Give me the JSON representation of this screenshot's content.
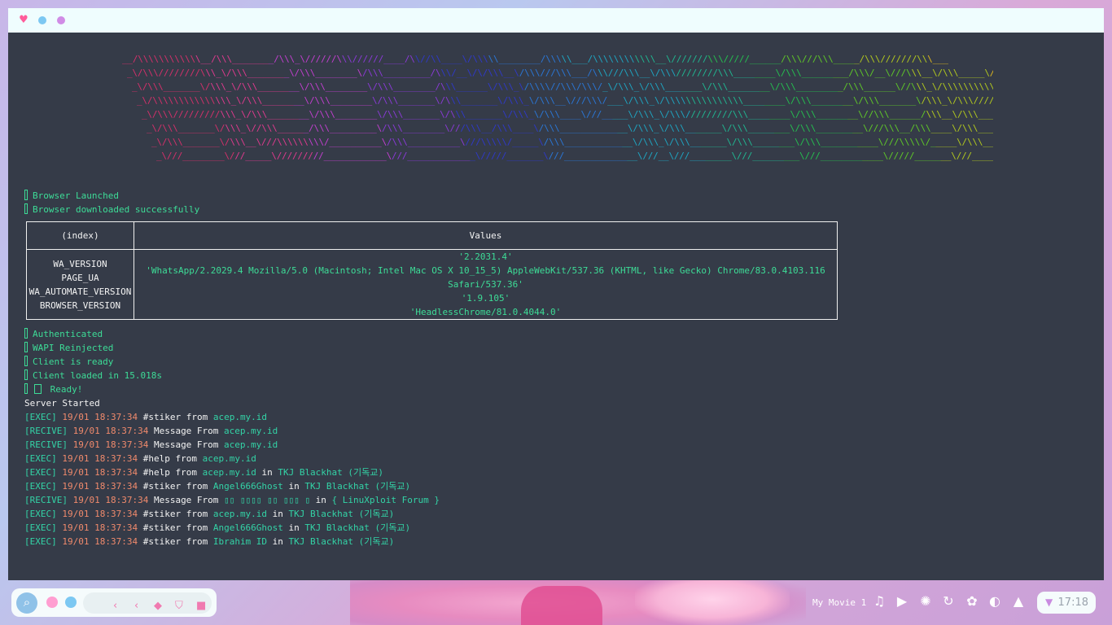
{
  "window": {
    "controls": [
      "close",
      "minimize",
      "maximize"
    ]
  },
  "banner": [
    {
      "text": "__/\\\\\\\\\\\\\\\\\\\\\\\\__/\\\\\\________/\\\\\\_\\//////\\\\\\//////____/\\\\//\\\\____\\/\\\\\\\\\\________/\\\\\\\\\\___/\\\\\\\\\\\\\\\\\\\\\\\\__\\///////\\\\\\/////______/\\\\\\///\\\\\\_____/\\\\\\///////\\\\\\___"
    },
    {
      "text": "_\\/\\\\\\////////\\\\\\_\\/\\\\\\________\\/\\\\\\________\\/\\\\\\_________/\\\\\\/__\\/\\/\\\\\\__\\/\\\\\\///\\\\\\___/\\\\\\///\\\\\\__\\/\\\\\\////////\\\\\\________\\/\\\\\\_________/\\\\\\/__\\///\\\\\\__\\/\\\\\\_____\\/\\\\\\___"
    },
    {
      "text": "_\\/\\\\\\_______\\/\\\\\\_\\/\\\\\\________\\/\\\\\\________\\/\\\\\\________/\\\\\\______\\/\\\\\\_\\/\\\\\\\\//\\\\\\/\\\\\\/_\\/\\\\\\_\\/\\\\\\_______\\/\\\\\\________\\/\\\\\\_________/\\\\\\______\\//\\\\\\_\\/\\\\\\\\\\\\\\\\\\\\\\/____"
    },
    {
      "text": "_\\/\\\\\\\\\\\\\\\\\\\\\\\\\\\\\\_\\/\\\\\\________\\/\\\\\\________\\/\\\\\\_______\\/\\\\\\_______\\/\\\\\\_\\/\\\\\\__\\///\\\\\\/___\\/\\\\\\_\\/\\\\\\\\\\\\\\\\\\\\\\\\\\\\\\________\\/\\\\\\________\\/\\\\\\_______\\/\\\\\\_\\/\\\\\\//////\\\\\\____"
    },
    {
      "text": "_\\/\\\\\\/////////\\\\\\_\\/\\\\\\________\\/\\\\\\________\\/\\\\\\_______\\/\\\\\\_______\\/\\\\\\_\\/\\\\\\____\\///_____\\/\\\\\\_\\/\\\\\\/////////\\\\\\________\\/\\\\\\________\\//\\\\\\______/\\\\\\__\\/\\\\\\____\\//\\\\\\__"
    },
    {
      "text": "_\\/\\\\\\_______\\/\\\\\\_\\//\\\\\\______/\\\\\\_________\\/\\\\\\________\\///\\\\\\__/\\\\\\____\\/\\\\\\_____________\\/\\\\\\_\\/\\\\\\_______\\/\\\\\\________\\/\\\\\\_________\\///\\\\\\__/\\\\\\____\\/\\\\\\_____\\//\\\\\\_"
    },
    {
      "text": "_\\/\\\\\\_______\\/\\\\\\__\\///\\\\\\\\\\\\\\\\\\/__________\\/\\\\\\__________\\///\\\\\\\\\\/_____\\/\\\\\\_____________\\/\\\\\\_\\/\\\\\\_______\\/\\\\\\________\\/\\\\\\___________\\///\\\\\\\\\\/_____\\/\\\\\\______\\//\\\\\\"
    },
    {
      "text": "_\\///________\\///_____\\/////////____________\\///_____________\\/////_______\\///______________\\///__\\///________\\///_________\\///____________\\/////_______\\///________\\///__"
    }
  ],
  "log_top": [
    {
      "text": "Browser Launched"
    },
    {
      "text": "Browser downloaded successfully"
    }
  ],
  "table": {
    "header_index": "(index)",
    "header_values": "Values",
    "keys": [
      "WA_VERSION",
      "PAGE_UA",
      "WA_AUTOMATE_VERSION",
      "BROWSER_VERSION"
    ],
    "values": [
      "'2.2031.4'",
      "'WhatsApp/2.2029.4 Mozilla/5.0 (Macintosh; Intel Mac OS X 10_15_5) AppleWebKit/537.36 (KHTML, like Gecko) Chrome/83.0.4103.116 Safari/537.36'",
      "'1.9.105'",
      "'HeadlessChrome/81.0.4044.0'"
    ]
  },
  "log_mid": [
    {
      "text": "Authenticated"
    },
    {
      "text": "WAPI Reinjected"
    },
    {
      "text": "Client is ready"
    },
    {
      "text": "Client loaded in 15.018s"
    }
  ],
  "ready_text": "Ready!",
  "server_started": "Server Started",
  "events": [
    {
      "tag": "[EXEC]",
      "time": "19/01 18:37:34",
      "cmd": "#stiker",
      "verb": "from",
      "who": "acep.my.id",
      "in": "",
      "group": ""
    },
    {
      "tag": "[RECIVE]",
      "time": "19/01 18:37:34",
      "cmd": "Message",
      "verb": "From",
      "who": "acep.my.id",
      "in": "",
      "group": ""
    },
    {
      "tag": "[RECIVE]",
      "time": "19/01 18:37:34",
      "cmd": "Message",
      "verb": "From",
      "who": "acep.my.id",
      "in": "",
      "group": ""
    },
    {
      "tag": "[EXEC]",
      "time": "19/01 18:37:34",
      "cmd": "#help",
      "verb": "from",
      "who": "acep.my.id",
      "in": "",
      "group": ""
    },
    {
      "tag": "[EXEC]",
      "time": "19/01 18:37:34",
      "cmd": "#help",
      "verb": "from",
      "who": "acep.my.id",
      "in": "in",
      "group": "TKJ Blackhat (기독교)"
    },
    {
      "tag": "[EXEC]",
      "time": "19/01 18:37:34",
      "cmd": "#stiker",
      "verb": "from",
      "who": "Angel666Ghost",
      "in": "in",
      "group": "TKJ Blackhat (기독교)"
    },
    {
      "tag": "[RECIVE]",
      "time": "19/01 18:37:34",
      "cmd": "Message",
      "verb": "From",
      "who": "▯▯ ▯▯▯▯ ▯▯ ▯▯▯ ▯",
      "in": "in",
      "group": "{ LinuXploit Forum }"
    },
    {
      "tag": "[EXEC]",
      "time": "19/01 18:37:34",
      "cmd": "#stiker",
      "verb": "from",
      "who": "acep.my.id",
      "in": "in",
      "group": "TKJ Blackhat (기독교)"
    },
    {
      "tag": "[EXEC]",
      "time": "19/01 18:37:34",
      "cmd": "#stiker",
      "verb": "from",
      "who": "Angel666Ghost",
      "in": "in",
      "group": "TKJ Blackhat (기독교)"
    },
    {
      "tag": "[EXEC]",
      "time": "19/01 18:37:34",
      "cmd": "#stiker",
      "verb": "from",
      "who": "Ibrahim ID",
      "in": "in",
      "group": "TKJ Blackhat (기독교)"
    }
  ],
  "taskbar": {
    "search_icon": "search-icon",
    "nav_icons": [
      "chevron-left-icon",
      "chevron-left-icon",
      "diamond-icon",
      "shield-icon",
      "square-icon"
    ]
  },
  "tray": {
    "media_title": "My Movie 1",
    "icons": [
      "music-icon",
      "play-icon",
      "aperture-icon",
      "refresh-icon",
      "palette-icon",
      "toggle-icon",
      "mountain-icon"
    ],
    "clock": "17:18"
  },
  "colors": {
    "terminal_bg": "#353b48",
    "green": "#3ddc97",
    "orange": "#f08a6c",
    "titlebar": "#effdfe"
  }
}
